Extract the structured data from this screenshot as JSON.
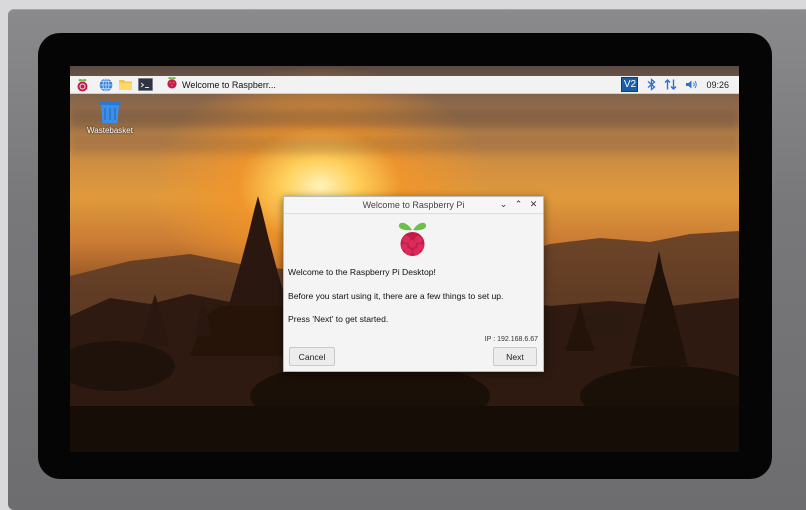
{
  "taskbar": {
    "active_window_label": "Welcome to Raspberr...",
    "vnc_label": "V2",
    "clock": "09:26"
  },
  "desktop": {
    "wastebasket_label": "Wastebasket"
  },
  "dialog": {
    "title": "Welcome to Raspberry Pi",
    "line1": "Welcome to the Raspberry Pi Desktop!",
    "line2": "Before you start using it, there are a few things to set up.",
    "line3": "Press 'Next' to get started.",
    "ip": "IP : 192.168.6.67",
    "cancel_label": "Cancel",
    "next_label": "Next"
  },
  "colors": {
    "raspberry_red": "#c51a4a",
    "leaf_green": "#6cc04a",
    "vnc_blue": "#1b5fa8"
  },
  "icons": [
    "raspberry-menu-icon",
    "web-browser-icon",
    "file-manager-icon",
    "terminal-icon",
    "vnc-icon",
    "bluetooth-icon",
    "network-icon",
    "volume-icon",
    "wastebasket-icon"
  ]
}
